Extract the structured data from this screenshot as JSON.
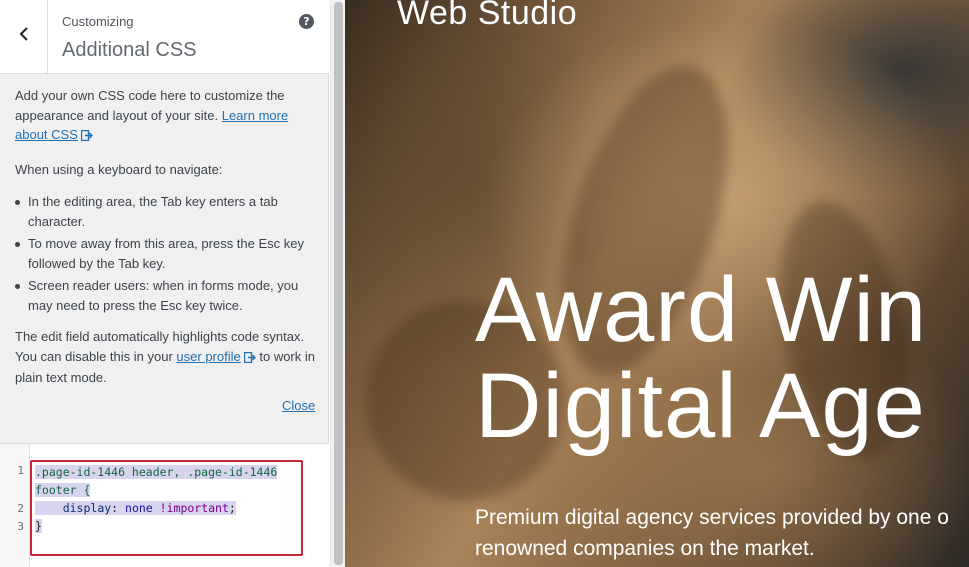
{
  "customizer": {
    "breadcrumb": "Customizing",
    "section_title": "Additional CSS",
    "help_icon_text": "?",
    "back_icon": "chevron-left-icon"
  },
  "description": {
    "intro_prefix": "Add your own CSS code here to customize the appearance and layout of your site.",
    "intro_link": "Learn more about CSS",
    "keyboard_heading": "When using a keyboard to navigate:",
    "bullets": [
      "In the editing area, the Tab key enters a tab character.",
      "To move away from this area, press the Esc key followed by the Tab key.",
      "Screen reader users: when in forms mode, you may need to press the Esc key twice."
    ],
    "syntax_prefix": "The edit field automatically highlights code syntax. You can disable this in your",
    "syntax_link": "user profile",
    "syntax_suffix": "to work in plain text mode.",
    "close_link": "Close"
  },
  "editor": {
    "line_numbers": [
      "1",
      "2",
      "3"
    ],
    "line1a_selector": ".page-id-1446 header, .page-id-1446",
    "line1b_selector": "footer {",
    "line2_property": "display",
    "line2_colon": ": ",
    "line2_value": "none",
    "line2_important": "!important",
    "line2_semicolon": ";",
    "line3": "}",
    "highlight_color": "#c6253f"
  },
  "preview": {
    "site_title": "Web Studio",
    "hero_line1": "Award Win",
    "hero_line2": "Digital Age",
    "subtitle_line1": "Premium digital agency services provided by one o",
    "subtitle_line2": "renowned companies on the market."
  }
}
